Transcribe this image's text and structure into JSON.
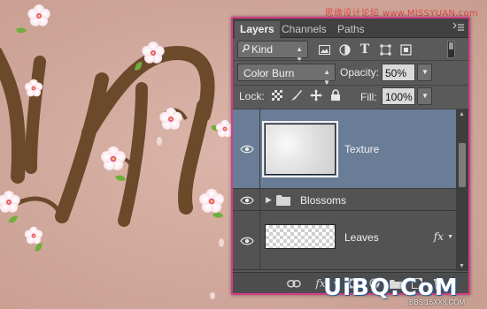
{
  "watermark_top": "思缘设计论坛 www.MISSYUAN.com",
  "watermark_logo": "UiBQ.CoM",
  "watermark_url": "BBS.16XX8.COM",
  "panel": {
    "tabs": [
      {
        "label": "Layers",
        "active": true
      },
      {
        "label": "Channels",
        "active": false
      },
      {
        "label": "Paths",
        "active": false
      }
    ],
    "filter": {
      "kind_label": "Kind",
      "icons": [
        "image-filter-icon",
        "adjustment-filter-icon",
        "type-filter-icon",
        "shape-filter-icon",
        "smart-object-filter-icon"
      ]
    },
    "blend_mode": "Color Burn",
    "opacity_label": "Opacity:",
    "opacity_value": "50%",
    "lock_label": "Lock:",
    "fill_label": "Fill:",
    "fill_value": "100%",
    "layers": [
      {
        "name": "Texture",
        "selected": true,
        "type": "pixel"
      },
      {
        "name": "Blossoms",
        "selected": false,
        "type": "group"
      },
      {
        "name": "Leaves",
        "selected": false,
        "type": "pixel",
        "has_fx": true,
        "fx_label": "fx"
      }
    ],
    "bottom_fx": "fx"
  },
  "colors": {
    "panel_border": "#d63a86",
    "selected_row": "#6a7d96",
    "panel_bg": "#5a5a5a"
  }
}
